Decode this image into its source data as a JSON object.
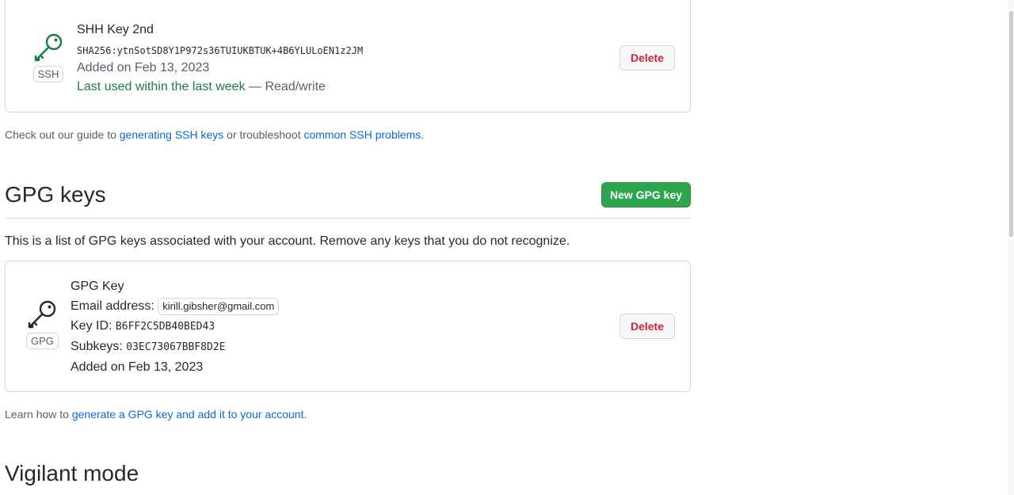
{
  "ssh_key": {
    "title": "SHH Key 2nd",
    "fingerprint": "SHA256:ytnSotSD8Y1P972s36TUIUKBTUK+4B6YLULoEN1z2JM",
    "added": "Added on Feb 13, 2023",
    "last_used": "Last used within the last week",
    "access": "— Read/write",
    "badge": "SSH",
    "delete_label": "Delete",
    "icon": "key-icon"
  },
  "ssh_help": {
    "prefix": "Check out our guide to ",
    "link1": "generating SSH keys",
    "middle": " or troubleshoot ",
    "link2": "common SSH problems",
    "suffix": "."
  },
  "gpg_section": {
    "title": "GPG keys",
    "new_button": "New GPG key",
    "intro": "This is a list of GPG keys associated with your account. Remove any keys that you do not recognize."
  },
  "gpg_key": {
    "title": "GPG Key",
    "email_label": "Email address:",
    "email": "kirill.gibsher@gmail.com",
    "key_id_label": "Key ID:",
    "key_id": "B6FF2C5DB40BED43",
    "subkeys_label": "Subkeys:",
    "subkeys": "03EC73067BBF8D2E",
    "added": "Added on Feb 13, 2023",
    "badge": "GPG",
    "delete_label": "Delete",
    "icon": "key-icon"
  },
  "gpg_help": {
    "prefix": "Learn how to ",
    "link": "generate a GPG key and add it to your account",
    "suffix": "."
  },
  "vigilant": {
    "title": "Vigilant mode"
  },
  "colors": {
    "green_button": "#2da44e",
    "link": "#0969da",
    "danger": "#cf222e",
    "success_text": "#1a7f37"
  }
}
